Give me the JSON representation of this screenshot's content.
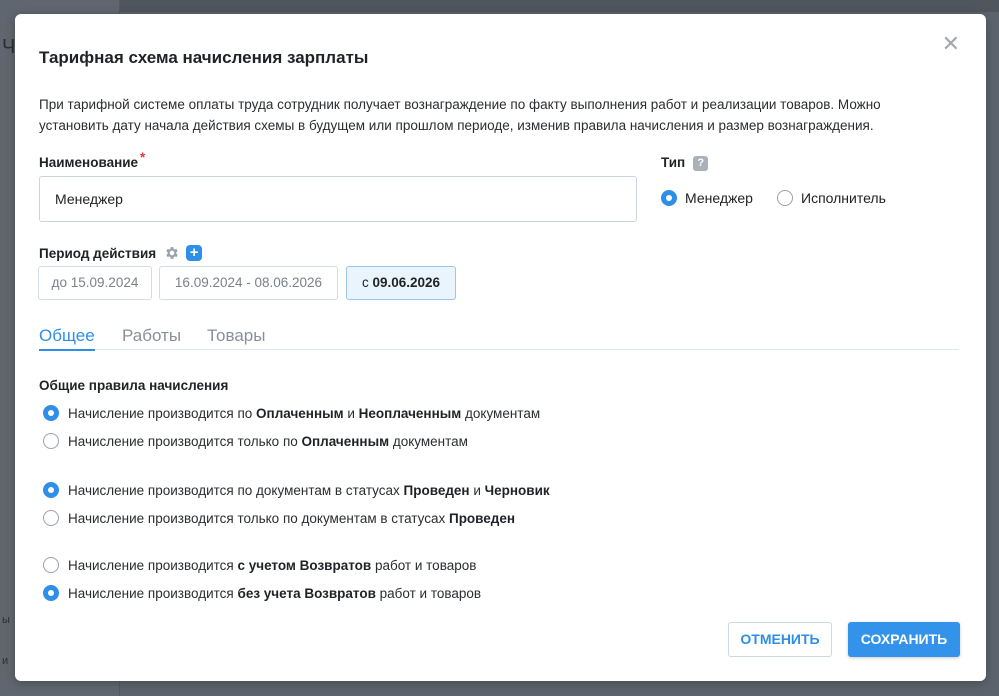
{
  "background": {
    "frag_top": "Ч",
    "frag_mid": "ы",
    "frag_low": "и"
  },
  "modal": {
    "title": "Тарифная схема начисления зарплаты",
    "close_icon": "close-icon",
    "description": "При тарифной системе оплаты труда сотрудник получает вознаграждение по факту выполнения работ и реализации товаров. Можно установить дату начала действия схемы в будущем или прошлом периоде, изменив правила начисления и размер вознаграждения.",
    "name_label": "Наименование",
    "required_mark": "*",
    "name_value": "Менеджер",
    "type_label": "Тип",
    "type_help": "?",
    "type_options": [
      {
        "label": "Менеджер",
        "selected": true
      },
      {
        "label": "Исполнитель",
        "selected": false
      }
    ],
    "period_label": "Период действия",
    "period_add": "+",
    "periods": [
      {
        "label": "до 15.09.2024",
        "active": false
      },
      {
        "label": "16.09.2024 - 08.06.2026",
        "active": false
      },
      {
        "prefix": "с ",
        "date": "09.06.2026",
        "active": true
      }
    ],
    "tabs": [
      "Общее",
      "Работы",
      "Товары"
    ],
    "active_tab": "Общее",
    "section_title": "Общие правила начисления",
    "rules": [
      {
        "selected": true,
        "parts": [
          "Начисление производится по ",
          "Оплаченным",
          " и ",
          "Неоплаченным",
          " документам"
        ]
      },
      {
        "selected": false,
        "parts": [
          "Начисление производится только по ",
          "Оплаченным",
          " документам"
        ]
      },
      {
        "selected": true,
        "parts": [
          "Начисление производится по документам в статусах ",
          "Проведен",
          " и ",
          "Черновик"
        ]
      },
      {
        "selected": false,
        "parts": [
          "Начисление производится только по документам в статусах ",
          "Проведен"
        ]
      },
      {
        "selected": false,
        "parts": [
          "Начисление производится ",
          "с учетом Возвратов",
          " работ и товаров"
        ]
      },
      {
        "selected": true,
        "parts": [
          "Начисление производится ",
          "без учета Возвратов",
          " работ и товаров"
        ]
      }
    ],
    "cancel_label": "ОТМЕНИТЬ",
    "save_label": "СОХРАНИТЬ"
  },
  "colors": {
    "accent": "#2f8ee8",
    "required": "#e53935",
    "overlay": "#5c636c"
  }
}
